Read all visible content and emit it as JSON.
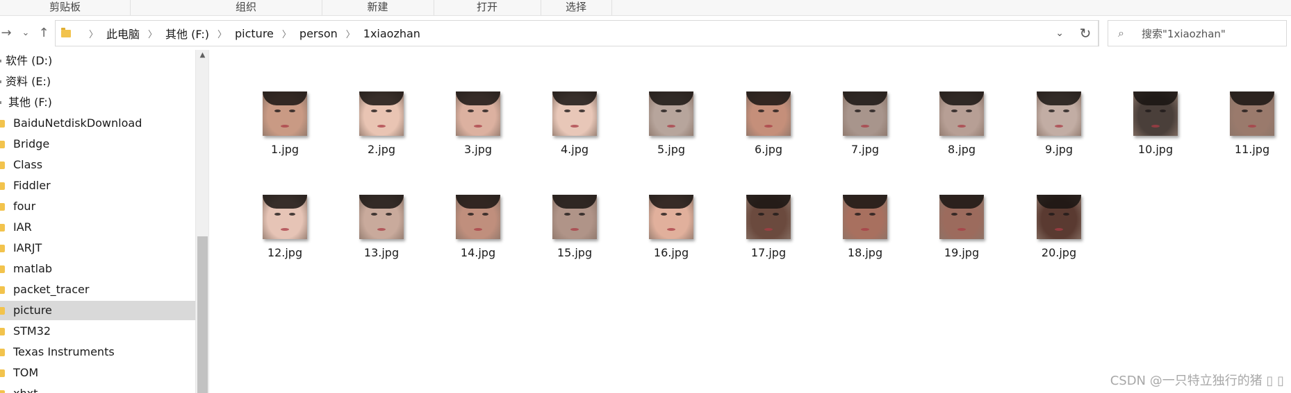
{
  "ribbon": {
    "groups": [
      "剪贴板",
      "组织",
      "新建",
      "打开",
      "选择"
    ]
  },
  "address": {
    "breadcrumbs": [
      "此电脑",
      "其他 (F:)",
      "picture",
      "person",
      "1xiaozhan"
    ],
    "search_placeholder": "搜索\"1xiaozhan\""
  },
  "nav": {
    "drives": [
      "软件 (D:)",
      "资料 (E:)",
      "其他 (F:)"
    ],
    "folders": [
      "BaiduNetdiskDownload",
      "Bridge",
      "Class",
      "Fiddler",
      "four",
      "IAR",
      "IARJT",
      "matlab",
      "packet_tracer",
      "picture",
      "STM32",
      "Texas Instruments",
      "TOM",
      "xhxt"
    ],
    "selected": "picture"
  },
  "files": [
    {
      "name": "1.jpg",
      "tone": "#c99a84"
    },
    {
      "name": "2.jpg",
      "tone": "#e9c4b3"
    },
    {
      "name": "3.jpg",
      "tone": "#dcb1a0"
    },
    {
      "name": "4.jpg",
      "tone": "#e8c7b8"
    },
    {
      "name": "5.jpg",
      "tone": "#b7a59c"
    },
    {
      "name": "6.jpg",
      "tone": "#c58f7a"
    },
    {
      "name": "7.jpg",
      "tone": "#a8958c"
    },
    {
      "name": "8.jpg",
      "tone": "#b79f95"
    },
    {
      "name": "9.jpg",
      "tone": "#c2ada4"
    },
    {
      "name": "10.jpg",
      "tone": "#4a3f3a"
    },
    {
      "name": "11.jpg",
      "tone": "#9a7a6c"
    },
    {
      "name": "12.jpg",
      "tone": "#e6c4b6"
    },
    {
      "name": "13.jpg",
      "tone": "#c9aa9c"
    },
    {
      "name": "14.jpg",
      "tone": "#c08f7d"
    },
    {
      "name": "15.jpg",
      "tone": "#b09488"
    },
    {
      "name": "16.jpg",
      "tone": "#e1b09c"
    },
    {
      "name": "17.jpg",
      "tone": "#6b4a3e"
    },
    {
      "name": "18.jpg",
      "tone": "#a8705f"
    },
    {
      "name": "19.jpg",
      "tone": "#9c6b5d"
    },
    {
      "name": "20.jpg",
      "tone": "#5a3a31"
    }
  ],
  "watermark": "CSDN @一只特立独行的猪 ▯ ▯"
}
